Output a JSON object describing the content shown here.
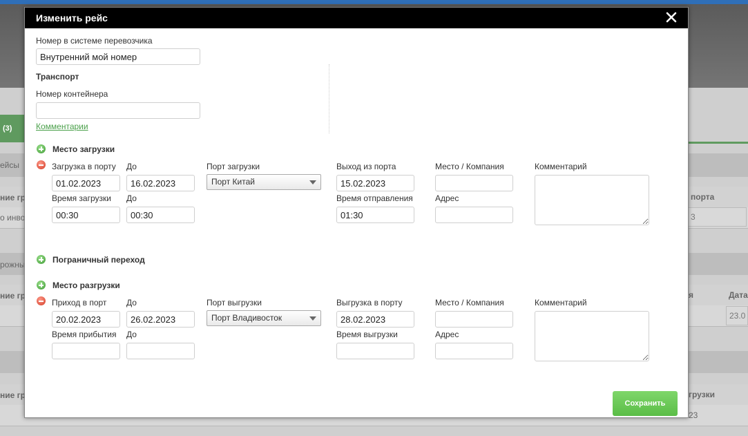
{
  "background": {
    "tab_count": "(3)",
    "left_labels": [
      "ейсы",
      "ние гр",
      "о инво",
      "рожны",
      "ние гр",
      "ние гр"
    ],
    "right_labels": [
      "порта",
      "3",
      "я",
      "Дата",
      "23.0",
      "грузки",
      "23"
    ]
  },
  "modal": {
    "title": "Изменить рейс",
    "carrier_number": {
      "label": "Номер в системе перевозчика",
      "value": "Внутренний мой номер"
    },
    "transport": {
      "heading": "Транспорт",
      "container_label": "Номер контейнера",
      "container_value": "",
      "comments_link": "Комментарии"
    },
    "loading": {
      "heading": "Место загрузки",
      "port_loading_label": "Загрузка в порту",
      "port_loading_value": "01.02.2023",
      "to_label": "До",
      "to_value": "16.02.2023",
      "port_label": "Порт загрузки",
      "port_value": "Порт Китай",
      "exit_label": "Выход из порта",
      "exit_value": "15.02.2023",
      "place_label": "Место / Компания",
      "place_value": "",
      "comment_label": "Комментарий",
      "time_label": "Время загрузки",
      "time_value": "00:30",
      "time_to_label": "До",
      "time_to_value": "00:30",
      "depart_time_label": "Время отправления",
      "depart_time_value": "01:30",
      "address_label": "Адрес",
      "address_value": ""
    },
    "border": {
      "heading": "Пограничный переход"
    },
    "unloading": {
      "heading": "Место разгрузки",
      "arrival_label": "Приход в порт",
      "arrival_value": "20.02.2023",
      "to_label": "До",
      "to_value": "26.02.2023",
      "port_label": "Порт выгрузки",
      "port_value": "Порт Владивосток",
      "unload_label": "Выгрузка в порту",
      "unload_value": "28.02.2023",
      "place_label": "Место / Компания",
      "place_value": "",
      "comment_label": "Комментарий",
      "arrival_time_label": "Время прибытия",
      "arrival_time_value": "",
      "time_to_label": "До",
      "time_to_value": "",
      "unload_time_label": "Время выгрузки",
      "unload_time_value": "",
      "address_label": "Адрес",
      "address_value": ""
    },
    "save_label": "Сохранить"
  }
}
